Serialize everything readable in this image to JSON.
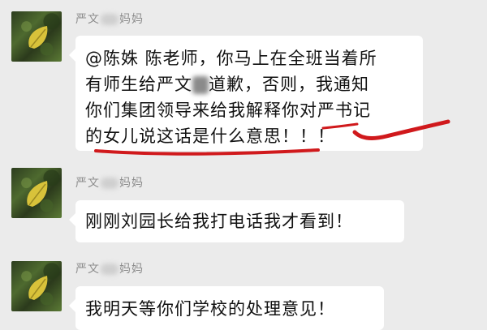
{
  "messages": [
    {
      "sender": {
        "prefix": "严文",
        "suffix": "妈妈"
      },
      "lines": [
        "@陈姝 陈老师，你马上在全班当着所",
        "有师生给严文",
        "道歉，否则，我通知",
        "你们集团领导来给我解释你对严书记",
        "的女儿说这话是什么意思！！！"
      ]
    },
    {
      "sender": {
        "prefix": "严文",
        "suffix": "妈妈"
      },
      "text": "刚刚刘园长给我打电话我才看到！"
    },
    {
      "sender": {
        "prefix": "严文",
        "suffix": "妈妈"
      },
      "text": "我明天等你们学校的处理意见！"
    }
  ],
  "colors": {
    "background": "#ebebeb",
    "bubble": "#ffffff",
    "annotation": "#d0191c"
  }
}
